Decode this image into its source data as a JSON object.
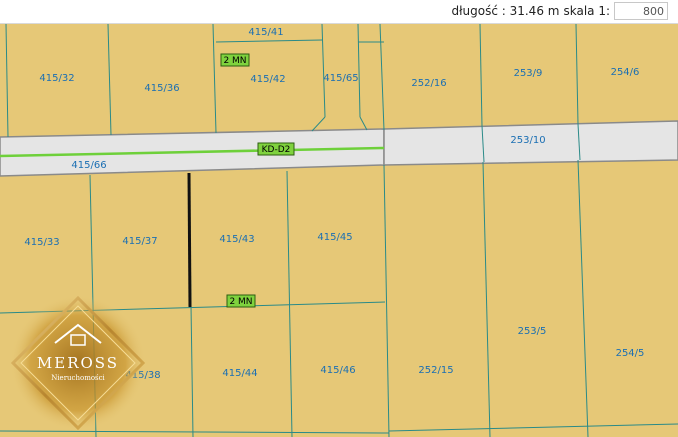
{
  "topbar": {
    "length_label": "długość : 31.46 m",
    "scale_label": "skala 1:",
    "scale_value": "800"
  },
  "parcels": [
    "415/41",
    "415/32",
    "415/36",
    "415/42",
    "415/65",
    "252/16",
    "253/9",
    "254/6",
    "253/10",
    "415/66",
    "415/33",
    "415/37",
    "415/43",
    "415/45",
    "253/5",
    "254/5",
    "415/38",
    "415/44",
    "415/46",
    "252/15"
  ],
  "zones": [
    "2 MN",
    "KD-D2",
    "2 MN"
  ],
  "logo": {
    "name": "MEROSS",
    "tagline": "Nieruchomości"
  },
  "colors": {
    "parcel_fill": "#e6c877",
    "road_fill": "#e5e5e5",
    "boundary": "#2a8a88",
    "label": "#1b6fb3",
    "zone_fill": "#7fd23e",
    "road_axis": "#6ed03a"
  }
}
